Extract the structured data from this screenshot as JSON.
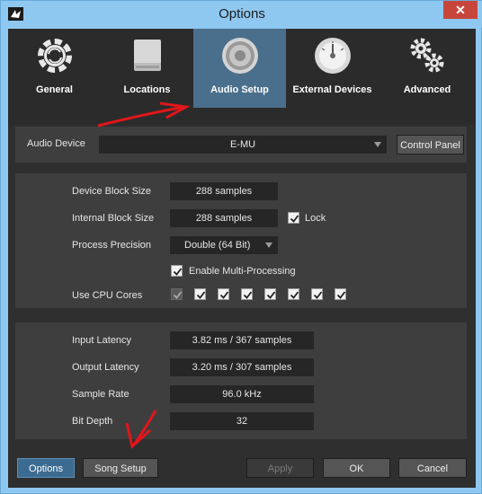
{
  "window": {
    "title": "Options",
    "close_label": "✕"
  },
  "tabs": [
    {
      "id": "general",
      "label": "General",
      "icon": "sync-gear-icon"
    },
    {
      "id": "locations",
      "label": "Locations",
      "icon": "drive-icon"
    },
    {
      "id": "audio-setup",
      "label": "Audio Setup",
      "icon": "speaker-icon",
      "active": true
    },
    {
      "id": "external-devices",
      "label": "External Devices",
      "icon": "gauge-icon"
    },
    {
      "id": "advanced",
      "label": "Advanced",
      "icon": "gears-icon"
    }
  ],
  "audio_device": {
    "label": "Audio Device",
    "value": "E-MU",
    "control_panel": "Control Panel"
  },
  "settings": {
    "device_block_size": {
      "label": "Device Block Size",
      "value": "288 samples"
    },
    "internal_block_size": {
      "label": "Internal Block Size",
      "value": "288 samples",
      "lock_label": "Lock",
      "lock_checked": true
    },
    "process_precision": {
      "label": "Process Precision",
      "value": "Double (64 Bit)"
    },
    "multi_processing": {
      "label": "Enable Multi-Processing",
      "checked": true
    },
    "cpu_cores": {
      "label": "Use CPU Cores",
      "cores": [
        true,
        true,
        true,
        true,
        true,
        true,
        true,
        true
      ]
    }
  },
  "info": {
    "input_latency": {
      "label": "Input Latency",
      "value": "3.82 ms / 367 samples"
    },
    "output_latency": {
      "label": "Output Latency",
      "value": "3.20 ms / 307 samples"
    },
    "sample_rate": {
      "label": "Sample Rate",
      "value": "96.0 kHz"
    },
    "bit_depth": {
      "label": "Bit Depth",
      "value": "32"
    }
  },
  "footer": {
    "options": "Options",
    "song_setup": "Song Setup",
    "apply": "Apply",
    "ok": "OK",
    "cancel": "Cancel"
  },
  "colors": {
    "accent": "#4a6f8c",
    "annotation_arrow": "#e0161b",
    "titlebar": "#8ec8f0"
  }
}
